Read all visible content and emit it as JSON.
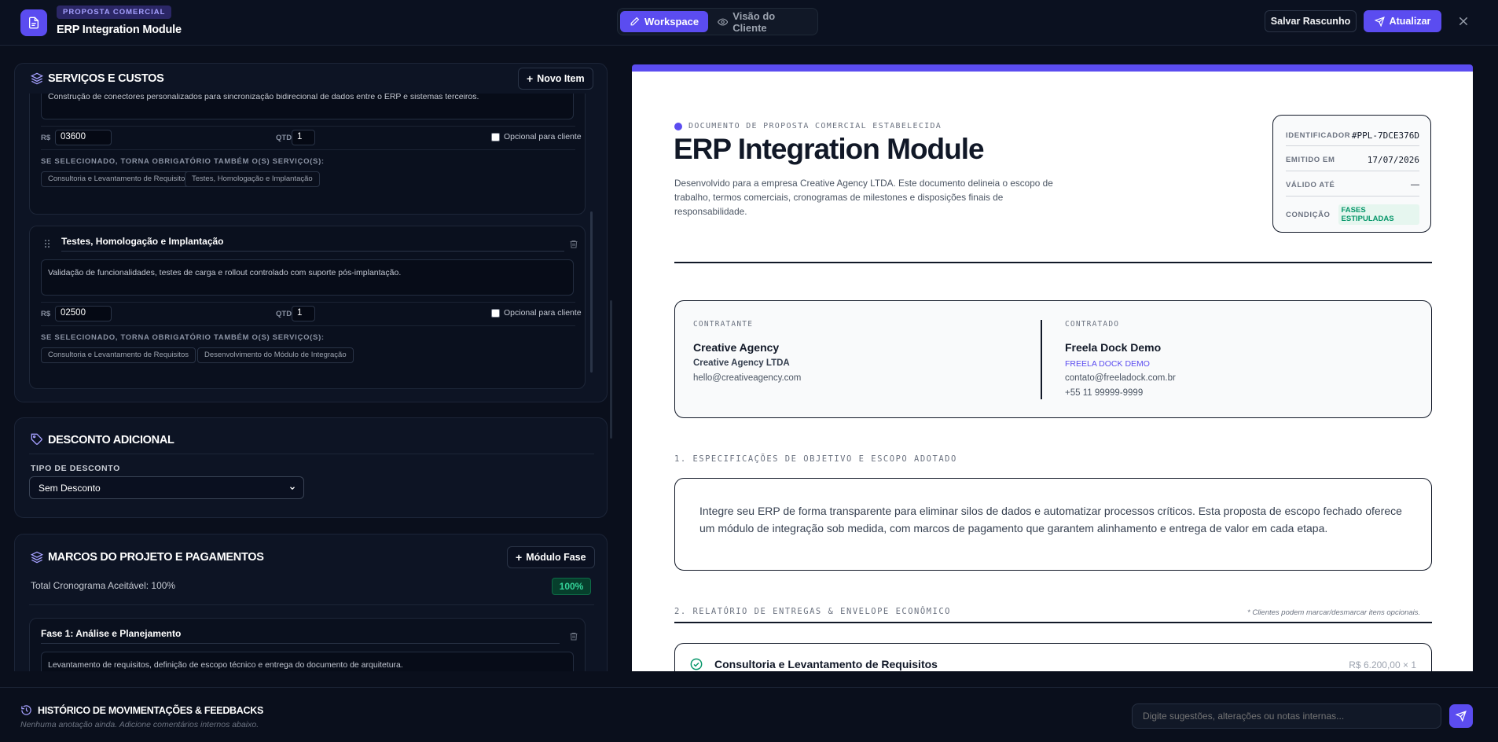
{
  "header": {
    "badge": "PROPOSTA COMERCIAL",
    "title": "ERP Integration Module",
    "tab_workspace": "Workspace",
    "tab_client": "Visão do Cliente",
    "save_draft": "Salvar Rascunho",
    "update": "Atualizar"
  },
  "services": {
    "title": "SERVIÇOS E CUSTOS",
    "new_item": "Novo Item",
    "currency": "R$",
    "qtd_label": "QTD",
    "optional_label": "Opcional para cliente",
    "dep_title": "SE SELECIONADO, TORNA OBRIGATÓRIO TAMBÉM O(S) SERVIÇO(S):",
    "items": [
      {
        "description": "Construção de conectores personalizados para sincronização bidirecional de dados entre o ERP e sistemas terceiros.",
        "price": "03600",
        "qty": "1",
        "deps": [
          "Consultoria e Levantamento de Requisitos",
          "Testes, Homologação e Implantação"
        ]
      },
      {
        "name": "Testes, Homologação e Implantação",
        "description": "Validação de funcionalidades, testes de carga e rollout controlado com suporte pós-implantação.",
        "price": "02500",
        "qty": "1",
        "deps": [
          "Consultoria e Levantamento de Requisitos",
          "Desenvolvimento do Módulo de Integração"
        ]
      }
    ]
  },
  "discount": {
    "title": "DESCONTO ADICIONAL",
    "type_label": "TIPO DE DESCONTO",
    "selected": "Sem Desconto"
  },
  "milestones": {
    "title": "MARCOS DO PROJETO E PAGAMENTOS",
    "add_button": "Módulo Fase",
    "total_label": "Total Cronograma Aceitável: 100%",
    "total_badge": "100%",
    "phase_name": "Fase 1: Análise e Planejamento",
    "phase_desc": "Levantamento de requisitos, definição de escopo técnico e entrega do documento de arquitetura."
  },
  "preview": {
    "eyebrow": "DOCUMENTO DE PROPOSTA COMERCIAL ESTABELECIDA",
    "title": "ERP Integration Module",
    "subtitle": "Desenvolvido para a empresa Creative Agency LTDA. Este documento delineia o escopo de trabalho, termos comerciais, cronogramas de milestones e disposições finais de responsabilidade.",
    "meta": {
      "id_label": "IDENTIFICADOR",
      "id_value": "#PPL-7DCE376D",
      "issued_label": "EMITIDO EM",
      "issued_value": "17/07/2026",
      "valid_label": "VÁLIDO ATÉ",
      "valid_value": "—",
      "cond_label": "CONDIÇÃO",
      "cond_value": "FASES ESTIPULADAS"
    },
    "client": {
      "label": "CONTRATANTE",
      "name": "Creative Agency",
      "company": "Creative Agency LTDA",
      "email": "hello@creativeagency.com"
    },
    "contractor": {
      "label": "CONTRATADO",
      "name": "Freela Dock Demo",
      "company": "FREELA DOCK DEMO",
      "email": "contato@freeladock.com.br",
      "phone": "+55 11 99999-9999"
    },
    "section1": "1. ESPECIFICAÇÕES DE OBJETIVO E ESCOPO ADOTADO",
    "scope": "Integre seu ERP de forma transparente para eliminar silos de dados e automatizar processos críticos. Esta proposta de escopo fechado oferece um módulo de integração sob medida, com marcos de pagamento que garantem alinhamento e entrega de valor em cada etapa.",
    "section2": "2. RELATÓRIO DE ENTREGAS & ENVELOPE ECONÔMICO",
    "section2_note": "* Clientes podem marcar/desmarcar itens opcionais.",
    "service_name": "Consultoria e Levantamento de Requisitos",
    "service_price": "R$ 6.200,00 × 1"
  },
  "history": {
    "title": "HISTÓRICO DE MOVIMENTAÇÕES & FEEDBACKS",
    "empty": "Nenhuma anotação ainda. Adicione comentários internos abaixo.",
    "placeholder": "Digite sugestões, alterações ou notas internas..."
  },
  "colors": {
    "accent": "#5b4cf0",
    "success": "#34d399",
    "background": "#0a0f1c"
  }
}
